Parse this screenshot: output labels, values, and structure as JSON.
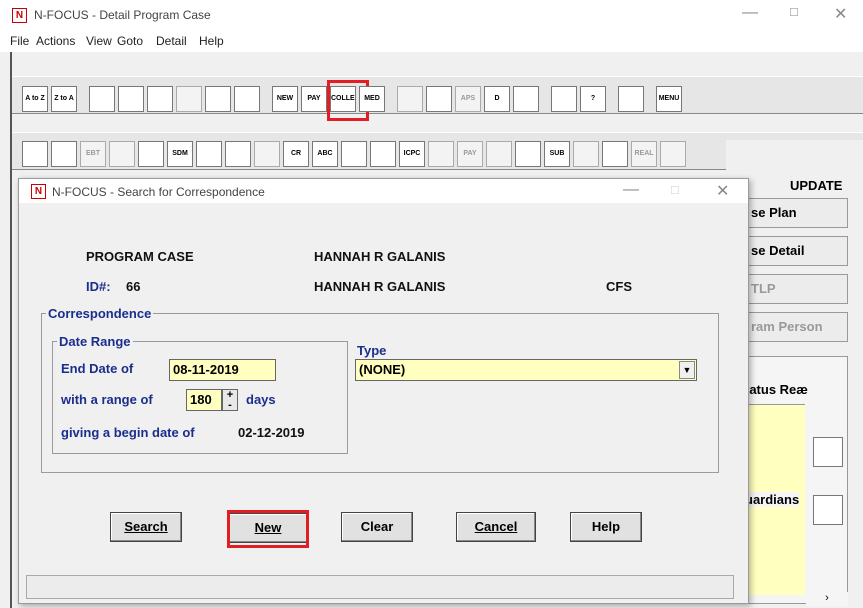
{
  "main_window": {
    "title": "N-FOCUS - Detail Program Case",
    "logo": "N",
    "menu": [
      "File",
      "Actions",
      "View",
      "Goto",
      "Detail",
      "Help"
    ]
  },
  "toolbar1_icons": [
    {
      "name": "sort-az-icon",
      "text": "A to Z"
    },
    {
      "name": "sort-za-icon",
      "text": "Z to A"
    },
    {
      "name": "tools-icon",
      "text": ""
    },
    {
      "name": "eraser-icon",
      "text": ""
    },
    {
      "name": "form-icon",
      "text": ""
    },
    {
      "name": "document-icon",
      "text": ""
    },
    {
      "name": "edit-doc-icon",
      "text": ""
    },
    {
      "name": "bookmark-icon",
      "text": ""
    },
    {
      "name": "new-correspondence-icon",
      "text": "NEW"
    },
    {
      "name": "pay-icon",
      "text": "PAY"
    },
    {
      "name": "collect-icon",
      "text": "COLLECT"
    },
    {
      "name": "med-icon",
      "text": "MED"
    },
    {
      "name": "copy-icon",
      "text": ""
    },
    {
      "name": "people-icon",
      "text": ""
    },
    {
      "name": "aps-icon",
      "text": "APS"
    },
    {
      "name": "d-icon",
      "text": "D"
    },
    {
      "name": "calendar-icon",
      "text": ""
    },
    {
      "name": "bar-chart-icon",
      "text": ""
    },
    {
      "name": "help-question-icon",
      "text": "?"
    },
    {
      "name": "open-folder-icon",
      "text": ""
    },
    {
      "name": "menu-icon",
      "text": "MENU"
    }
  ],
  "toolbar2_icons": [
    {
      "name": "family-icon",
      "text": ""
    },
    {
      "name": "transfer-icon",
      "text": ""
    },
    {
      "name": "ebt-icon",
      "text": "EBT"
    },
    {
      "name": "building-icon",
      "text": ""
    },
    {
      "name": "house-icon",
      "text": ""
    },
    {
      "name": "sdm-icon",
      "text": "SDM"
    },
    {
      "name": "phone-icon",
      "text": ""
    },
    {
      "name": "phone-alt-icon",
      "text": ""
    },
    {
      "name": "grid-edit-icon",
      "text": ""
    },
    {
      "name": "cr-icon",
      "text": "CR"
    },
    {
      "name": "abc-icon",
      "text": "ABC"
    },
    {
      "name": "court-icon",
      "text": ""
    },
    {
      "name": "handshake-icon",
      "text": ""
    },
    {
      "name": "icpc-icon",
      "text": "ICPC"
    },
    {
      "name": "edit-person-icon",
      "text": ""
    },
    {
      "name": "pay-dollar-icon",
      "text": "PAY"
    },
    {
      "name": "child-icon",
      "text": ""
    },
    {
      "name": "telephone-icon",
      "text": ""
    },
    {
      "name": "sub-dollar-icon",
      "text": "SUB"
    },
    {
      "name": "list-edit-icon",
      "text": ""
    },
    {
      "name": "family-edit-icon",
      "text": ""
    },
    {
      "name": "real-icon",
      "text": "REAL"
    },
    {
      "name": "dollar-box-icon",
      "text": ""
    }
  ],
  "right_panel": {
    "update_label": "UPDATE",
    "buttons": [
      "se Plan",
      "se Detail",
      "TLP",
      "ram Person"
    ],
    "status_header": "tatus Reæ",
    "guardians": "uardians"
  },
  "dialog": {
    "title": "N-FOCUS - Search for Correspondence",
    "program_case_label": "PROGRAM CASE",
    "program_case_name": "HANNAH R GALANIS",
    "id_label": "ID#:",
    "id_value": "66",
    "id_name": "HANNAH R GALANIS",
    "program": "CFS",
    "correspondence_legend": "Correspondence",
    "date_range_legend": "Date Range",
    "end_date_label": "End Date of",
    "end_date_value": "08-11-2019",
    "range_label": "with a range of",
    "range_value": "180",
    "range_unit": "days",
    "begin_date_label": "giving a begin date of",
    "begin_date_value": "02-12-2019",
    "type_label": "Type",
    "type_value": "(NONE)"
  },
  "buttons": {
    "search": "Search",
    "new": "New",
    "clear": "Clear",
    "cancel": "Cancel",
    "help": "Help"
  },
  "colors": {
    "highlight": "#e21d24",
    "field_bg": "#ffffc0",
    "label_blue": "#1a2e8c"
  }
}
